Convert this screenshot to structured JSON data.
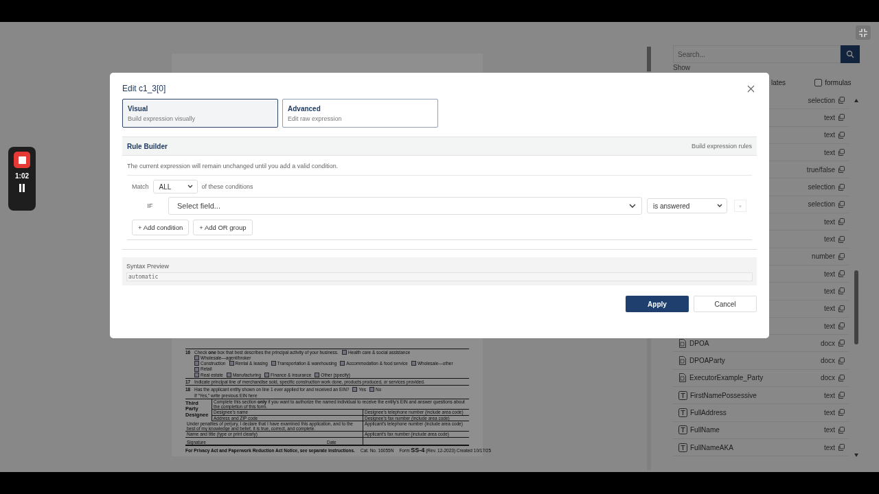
{
  "recorder": {
    "time": "1:02"
  },
  "document": {
    "choice": {
      "number": "16",
      "text": "Check **one** box that best describes the principal activity of your business.",
      "options": [
        [
          "Health care & social assistance",
          "Wholesale—agent/broker"
        ],
        [
          "Construction",
          "Rental & leasing",
          "Transportation & warehousing",
          "Accommodation & food service",
          "Wholesale—other",
          "Retail"
        ],
        [
          "Real estate",
          "Manufacturing",
          "Finance & insurance",
          "Other (specify)"
        ]
      ]
    },
    "line17": {
      "number": "17",
      "text": "Indicate principal line of merchandise sold, specific construction work done, products produced, or services provided."
    },
    "line18": {
      "number": "18",
      "text": "Has the applicant entity shown on line 1 ever applied for and received an EIN?",
      "options": [
        "Yes",
        "No"
      ],
      "note": "If “Yes,” write previous EIN here"
    },
    "designee": {
      "heading": "Third Party Designee",
      "intro": "Complete this section **only** if you want to authorize the named individual to receive the entity's EIN and answer questions about the completion of this form.",
      "fields": [
        {
          "label": "Designee's name",
          "side": "Designee's telephone number (include area code)"
        },
        {
          "label": "Address and ZIP code",
          "side": "Designee's fax number (include area code)"
        }
      ]
    },
    "signature": {
      "declaration": "Under penalties of perjury, I declare that I have examined this application, and to the best of my knowledge and belief, it is true, correct, and complete.",
      "phone": "Applicant's telephone number (include area code)",
      "name_title": "Name and title (type or print clearly)",
      "fax": "Applicant's fax number (include area code)",
      "signature_label": "Signature",
      "date_label": "Date"
    },
    "footer": {
      "notice": "For Privacy Act and Paperwork Reduction Act Notice, see separate instructions.",
      "catalog": "Cat. No. 16055N",
      "form": "Form **SS-4** (Rev. 12-2023) Created 10/17/25"
    }
  },
  "sidebar": {
    "search": {
      "placeholder": "Search..."
    },
    "show_label": "Show",
    "filters": [
      {
        "label": "lates"
      },
      {
        "label": "formulas",
        "checked": false
      }
    ],
    "fields": [
      {
        "type": "selection"
      },
      {
        "type": "text"
      },
      {
        "type": "text"
      },
      {
        "type": "text"
      },
      {
        "type": "true/false"
      },
      {
        "type": "selection"
      },
      {
        "type": "selection"
      },
      {
        "type": "text"
      },
      {
        "type": "text"
      },
      {
        "type": "number"
      },
      {
        "type": "text"
      },
      {
        "type": "text"
      },
      {
        "type": "text"
      },
      {
        "type": "text"
      },
      {
        "name": "DPOA",
        "type": "docx",
        "kind": "document"
      },
      {
        "name": "DPOAParty",
        "type": "docx",
        "kind": "document"
      },
      {
        "name": "ExecutorExample_Party",
        "type": "docx",
        "kind": "document"
      },
      {
        "name": "FirstNamePossessive",
        "type": "text",
        "kind": "text"
      },
      {
        "name": "FullAddress",
        "type": "text",
        "kind": "text"
      },
      {
        "name": "FullName",
        "type": "text",
        "kind": "text"
      },
      {
        "name": "FullNameAKA",
        "type": "text",
        "kind": "text"
      }
    ]
  },
  "dialog": {
    "title": "Edit c1_3[0]",
    "modes": [
      {
        "title": "Visual",
        "subtitle": "Build expression visually",
        "selected": true
      },
      {
        "title": "Advanced",
        "subtitle": "Edit raw expression",
        "selected": false
      }
    ],
    "rule_builder": {
      "title": "Rule Builder",
      "hint": "Build expression rules",
      "note": "The current expression will remain unchanged until you add a valid condition.",
      "match_label": "Match",
      "match_value": "ALL",
      "match_suffix": "of these conditions",
      "conditions": [
        {
          "prefix": "IF",
          "placeholder": "Select field...",
          "operator": "is answered",
          "remove": "×"
        }
      ],
      "actions": [
        "+ Add condition",
        "+ Add OR group"
      ]
    },
    "syntax_preview": {
      "label": "Syntax Preview",
      "value": "automatic"
    },
    "buttons": [
      {
        "label": "Apply",
        "kind": "primary"
      },
      {
        "label": "Cancel",
        "kind": "secondary"
      }
    ]
  }
}
